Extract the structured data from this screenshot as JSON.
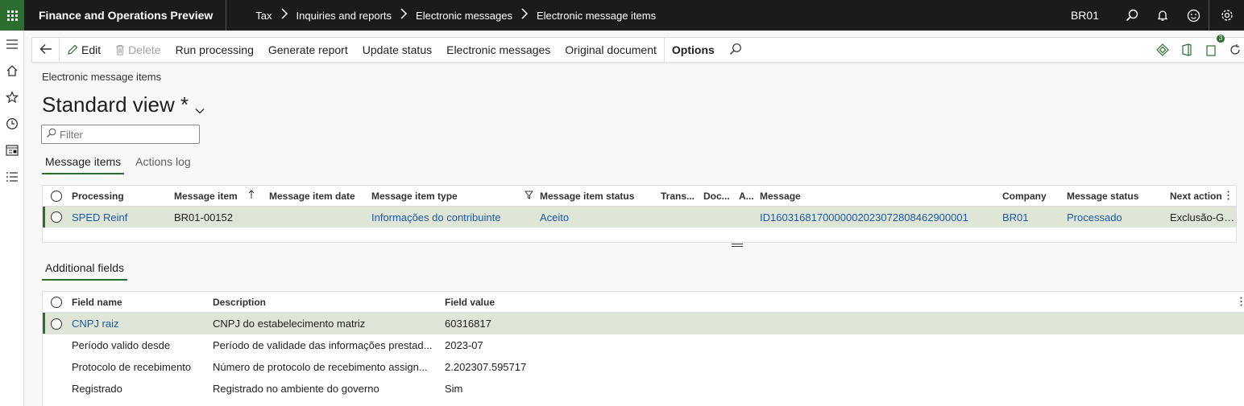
{
  "app": {
    "title": "Finance and Operations Preview"
  },
  "breadcrumb": [
    "Tax",
    "Inquiries and reports",
    "Electronic messages",
    "Electronic message items"
  ],
  "topbar": {
    "company": "BR01"
  },
  "actions": {
    "edit": "Edit",
    "delete": "Delete",
    "run_processing": "Run processing",
    "generate_report": "Generate report",
    "update_status": "Update status",
    "electronic_messages": "Electronic messages",
    "original_document": "Original document",
    "options": "Options",
    "attachments_count": "3"
  },
  "page": {
    "caption": "Electronic message items",
    "view_title": "Standard view *",
    "filter_placeholder": "Filter"
  },
  "tabs": [
    "Message items",
    "Actions log"
  ],
  "message_grid": {
    "columns": [
      "Processing",
      "Message item",
      "Message item date",
      "Message item type",
      "Message item status",
      "Trans...",
      "Doc...",
      "A...",
      "Message",
      "Company",
      "Message status",
      "Next action"
    ],
    "rows": [
      {
        "processing": "SPED Reinf",
        "message_item": "BR01-00152",
        "message_item_date": "",
        "message_item_type": "Informações do contribuinte",
        "message_item_status": "Aceito",
        "trans": "",
        "doc": "",
        "a": "",
        "message": "ID1603168170000002023072808462900001",
        "company": "BR01",
        "message_status": "Processado",
        "next_action": "Exclusão-Geral"
      }
    ]
  },
  "additional": {
    "tab": "Additional fields",
    "columns": [
      "Field name",
      "Description",
      "Field value"
    ],
    "rows": [
      {
        "field_name": "CNPJ raiz",
        "description": "CNPJ do estabelecimento matriz",
        "field_value": "60316817"
      },
      {
        "field_name": "Período valido desde",
        "description": "Período de validade das informações prestad...",
        "field_value": "2023-07"
      },
      {
        "field_name": "Protocolo de recebimento",
        "description": "Número de protocolo de recebimento assign...",
        "field_value": "2.202307.595717"
      },
      {
        "field_name": "Registrado",
        "description": "Registrado no ambiente do governo",
        "field_value": "Sim"
      }
    ]
  },
  "colors": {
    "accent": "#2b6e2f",
    "link": "#1e5aa8",
    "topbar": "#1b1b1b",
    "selected_row": "#dfe6d8"
  }
}
